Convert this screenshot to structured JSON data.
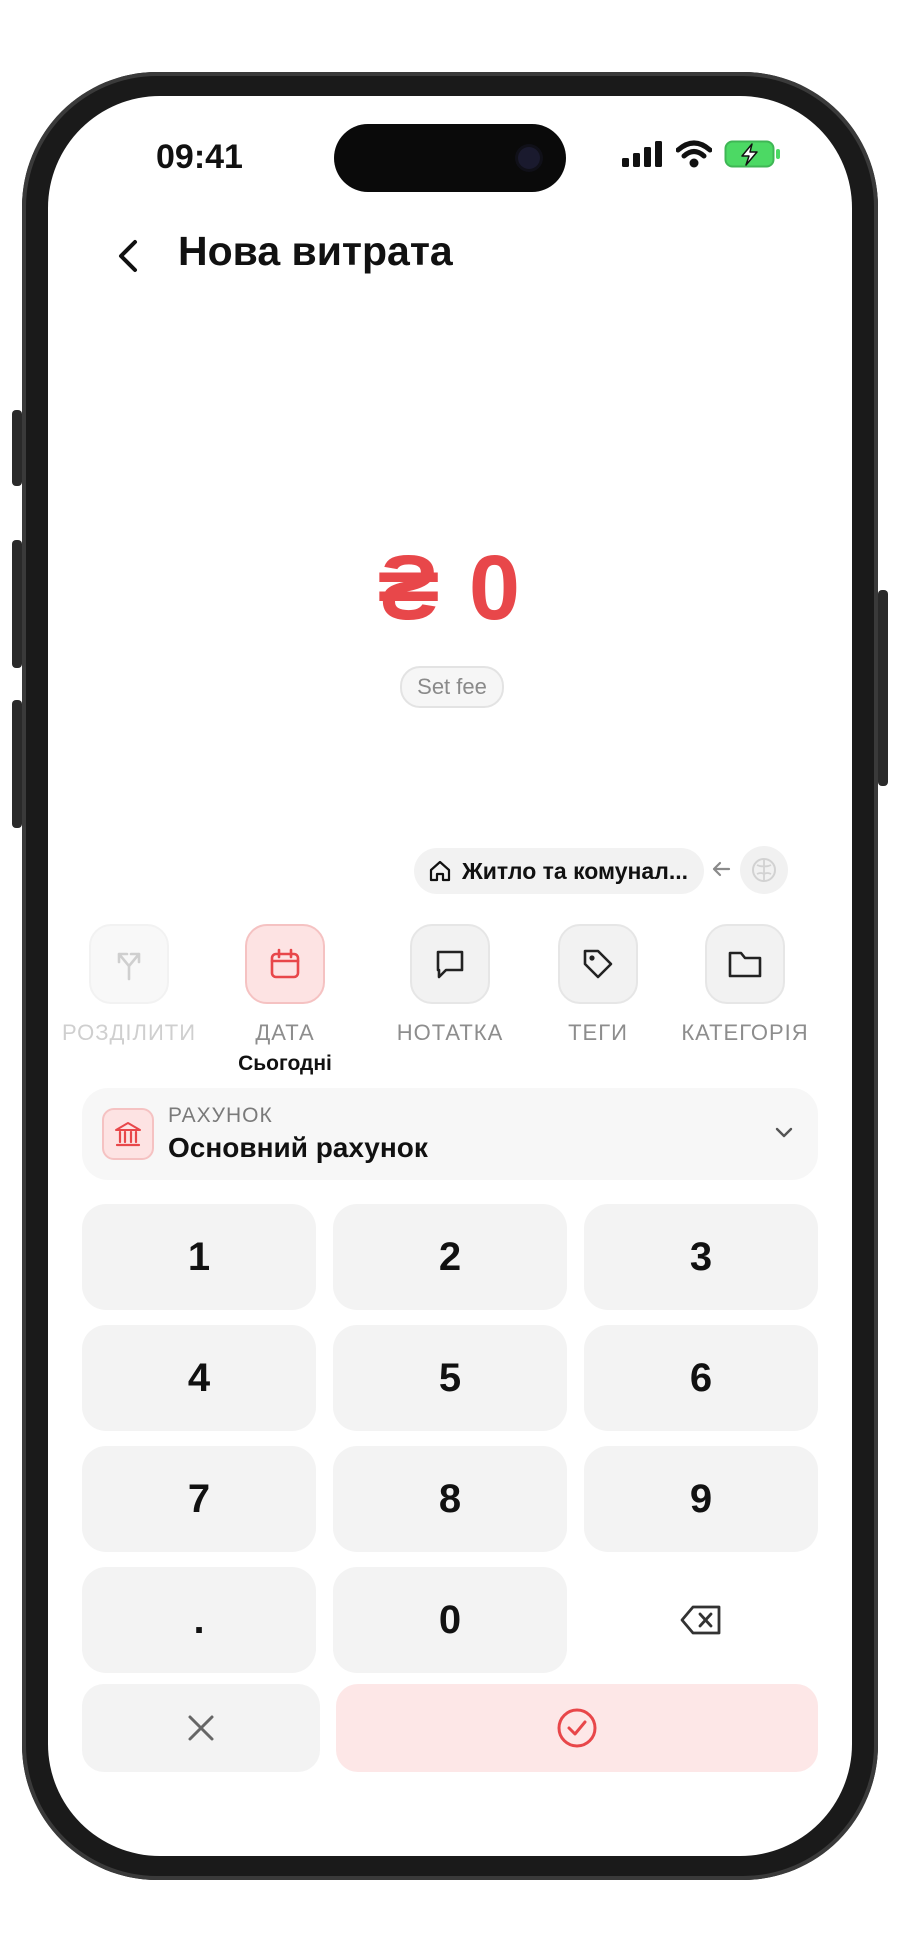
{
  "status": {
    "time": "09:41",
    "icons": [
      "cellular-signal-icon",
      "wifi-icon",
      "battery-charging-icon"
    ]
  },
  "header": {
    "title": "Нова витрата",
    "back_icon": "chevron-left-icon"
  },
  "amount": {
    "currency": "₴",
    "value": "0",
    "color": "#e8474a"
  },
  "fee": {
    "label": "Set fee"
  },
  "category_chip": {
    "icon": "home-icon",
    "label": "Житло та комунал..."
  },
  "actions": [
    {
      "id": "split",
      "label": "РОЗДІЛИТИ",
      "icon": "split-arrow-icon",
      "state": "disabled"
    },
    {
      "id": "date",
      "label": "ДАТА",
      "icon": "calendar-icon",
      "state": "active",
      "sub": "Сьогодні"
    },
    {
      "id": "note",
      "label": "НОТАТКА",
      "icon": "message-icon",
      "state": "normal"
    },
    {
      "id": "tags",
      "label": "ТЕГИ",
      "icon": "tag-icon",
      "state": "normal"
    },
    {
      "id": "category",
      "label": "КАТЕГОРІЯ",
      "icon": "folder-icon",
      "state": "normal"
    }
  ],
  "account": {
    "label": "РАХУНОК",
    "value": "Основний рахунок",
    "icon": "bank-icon"
  },
  "keypad": {
    "keys": [
      "1",
      "2",
      "3",
      "4",
      "5",
      "6",
      "7",
      "8",
      "9",
      ".",
      "0"
    ],
    "backspace_icon": "backspace-icon",
    "cancel_icon": "close-icon",
    "confirm_icon": "check-circle-icon"
  },
  "colors": {
    "accent": "#e8474a",
    "accent_soft": "#fde3e3",
    "key_bg": "#f3f3f3"
  }
}
